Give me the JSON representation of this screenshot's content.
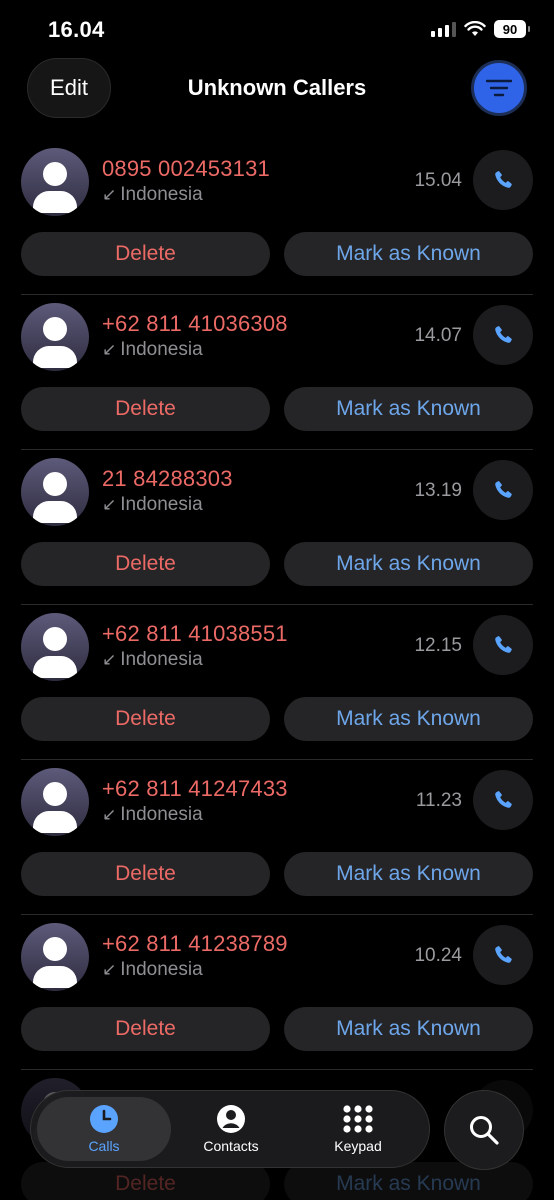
{
  "status": {
    "time": "16.04",
    "battery": "90"
  },
  "header": {
    "edit_label": "Edit",
    "title": "Unknown Callers"
  },
  "calls": [
    {
      "number": "0895 002453131",
      "origin": "Indonesia",
      "time": "15.04"
    },
    {
      "number": "+62 811 41036308",
      "origin": "Indonesia",
      "time": "14.07"
    },
    {
      "number": "21 84288303",
      "origin": "Indonesia",
      "time": "13.19"
    },
    {
      "number": "+62 811 41038551",
      "origin": "Indonesia",
      "time": "12.15"
    },
    {
      "number": "+62 811 41247433",
      "origin": "Indonesia",
      "time": "11.23"
    },
    {
      "number": "+62 811 41238789",
      "origin": "Indonesia",
      "time": "10.24"
    }
  ],
  "row_actions": {
    "delete_label": "Delete",
    "mark_known_label": "Mark as Known"
  },
  "tabs": {
    "calls": "Calls",
    "contacts": "Contacts",
    "keypad": "Keypad"
  },
  "colors": {
    "accent": "#5aa4ff",
    "missed_red": "#ec6a66",
    "filter_blue": "#2f64e8"
  },
  "icons": [
    "phone-icon",
    "person-icon",
    "filter-lines-icon",
    "clock-icon",
    "keypad-grid-icon",
    "search-icon",
    "incoming-arrow-icon",
    "wifi-icon",
    "signal-icon"
  ]
}
